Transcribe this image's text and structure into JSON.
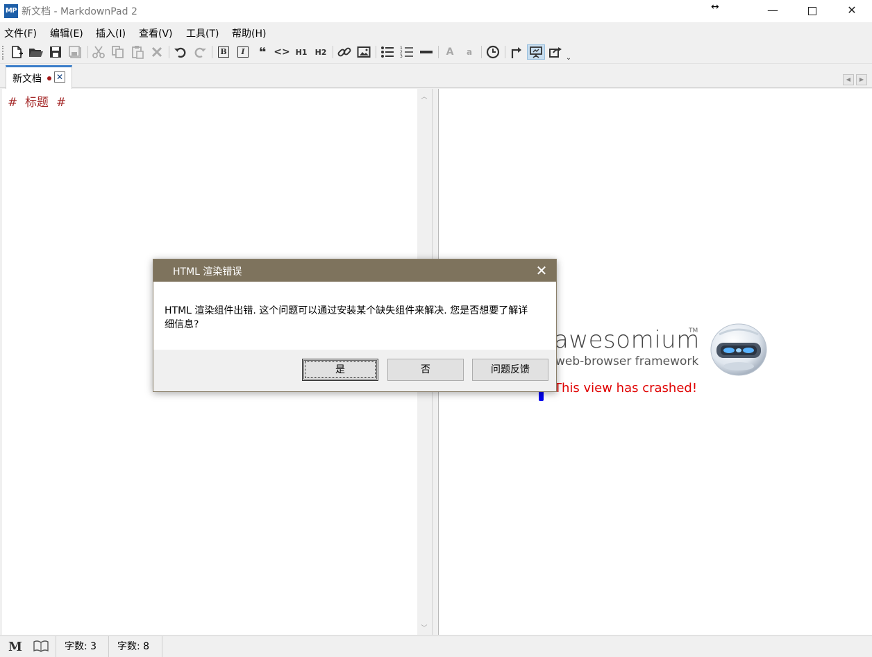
{
  "window": {
    "logo": "MP",
    "title": "新文档 - MarkdownPad 2",
    "resize_cursor": "↔",
    "minimize": "—",
    "close": "✕"
  },
  "menu": {
    "items": [
      "文件(F)",
      "编辑(E)",
      "插入(I)",
      "查看(V)",
      "工具(T)",
      "帮助(H)"
    ]
  },
  "toolbar": {
    "bold": "B",
    "italic": "I",
    "quote": "❝",
    "code": "<>",
    "h1": "H1",
    "h2": "H2",
    "font_large": "A",
    "font_small": "a"
  },
  "tabs": {
    "active_label": "新文档",
    "close_glyph": "✕",
    "nav_left": "◀",
    "nav_right": "▶"
  },
  "editor": {
    "line_1": "#  标题  #"
  },
  "preview": {
    "brand": "awesomium",
    "trademark": "TM",
    "tagline": "web-browser framework",
    "crash_message": "This view has crashed!"
  },
  "dialog": {
    "title": "HTML 渲染错误",
    "close_glyph": "✕",
    "message": "HTML 渲染组件出错. 这个问题可以通过安装某个缺失组件来解决. 您是否想要了解详细信息?",
    "yes": "是",
    "no": "否",
    "feedback": "问题反馈"
  },
  "statusbar": {
    "markdown_icon": "M",
    "book_icon": "📖",
    "word_count": "字数: 3",
    "char_count": "字数:  8"
  },
  "colors": {
    "dialog_titlebar": "#7e735d",
    "tab_accent": "#3a7dc9",
    "heading_text": "#a52a2a",
    "crash_text": "#e00000"
  }
}
